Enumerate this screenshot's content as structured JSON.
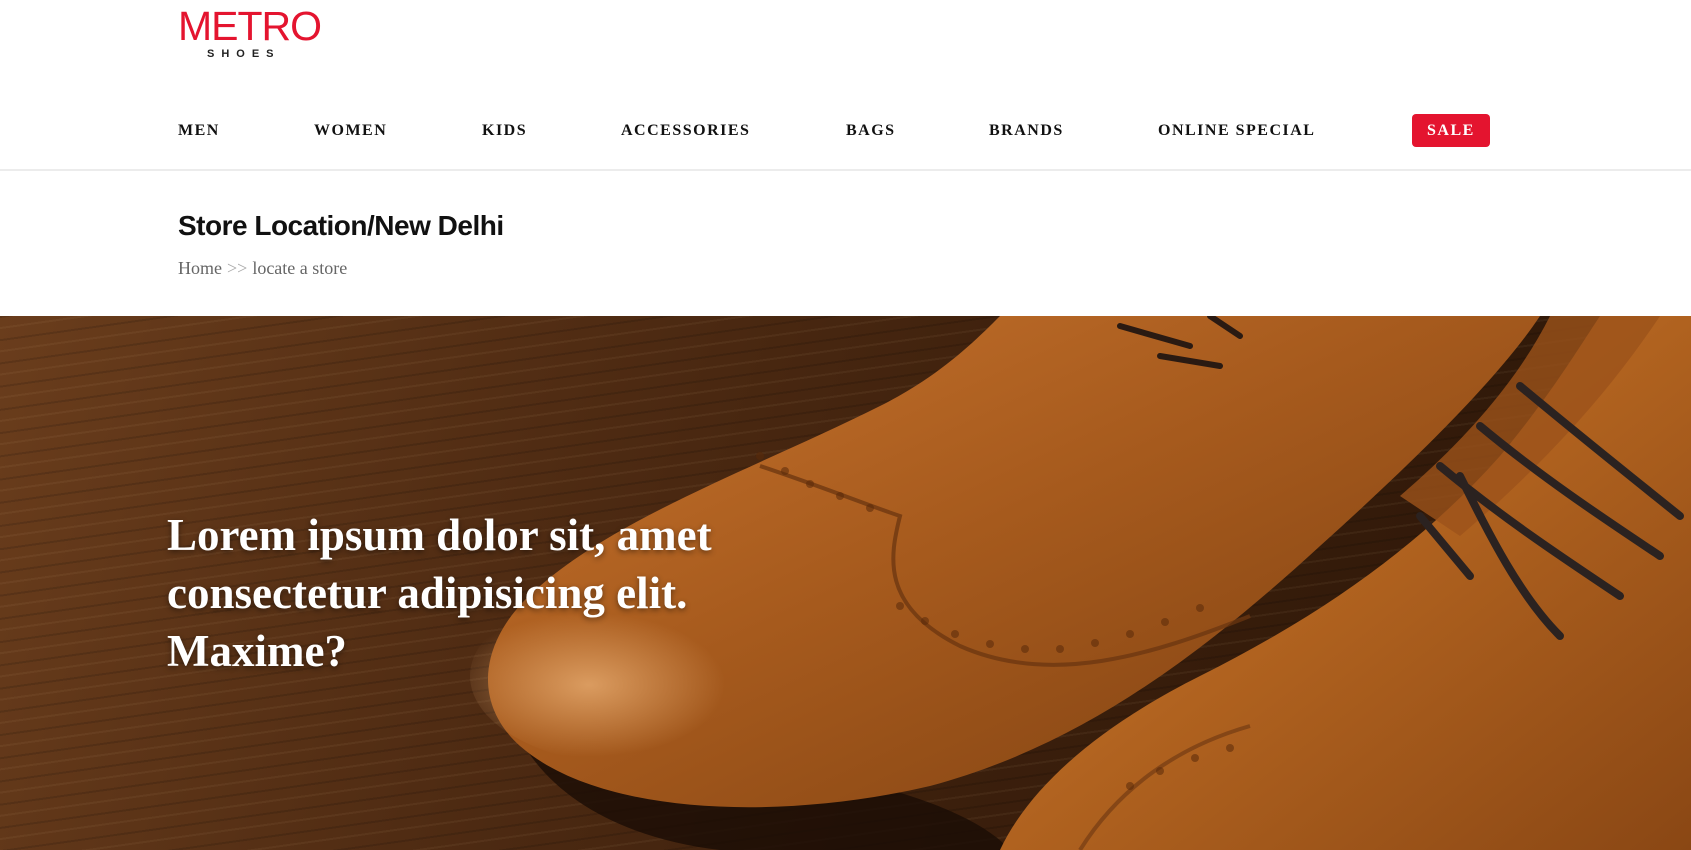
{
  "brand": {
    "logo_main": "METRO",
    "logo_sub": "SHOES",
    "color": "#e4142f"
  },
  "nav": {
    "items": [
      {
        "label": "MEN"
      },
      {
        "label": "WOMEN"
      },
      {
        "label": "KIDS"
      },
      {
        "label": "ACCESSORIES"
      },
      {
        "label": "BAGS"
      },
      {
        "label": "BRANDS"
      },
      {
        "label": "ONLINE SPECIAL"
      }
    ],
    "sale_label": "SALE"
  },
  "page": {
    "title": "Store Location/New Delhi",
    "breadcrumb": {
      "home": "Home",
      "separator": ">>",
      "current": "locate a store"
    }
  },
  "hero": {
    "heading": "Lorem ipsum dolor sit, amet consectetur adipisicing elit. Maxime?",
    "image": "brown-leather-brogue-shoes-on-wood"
  }
}
